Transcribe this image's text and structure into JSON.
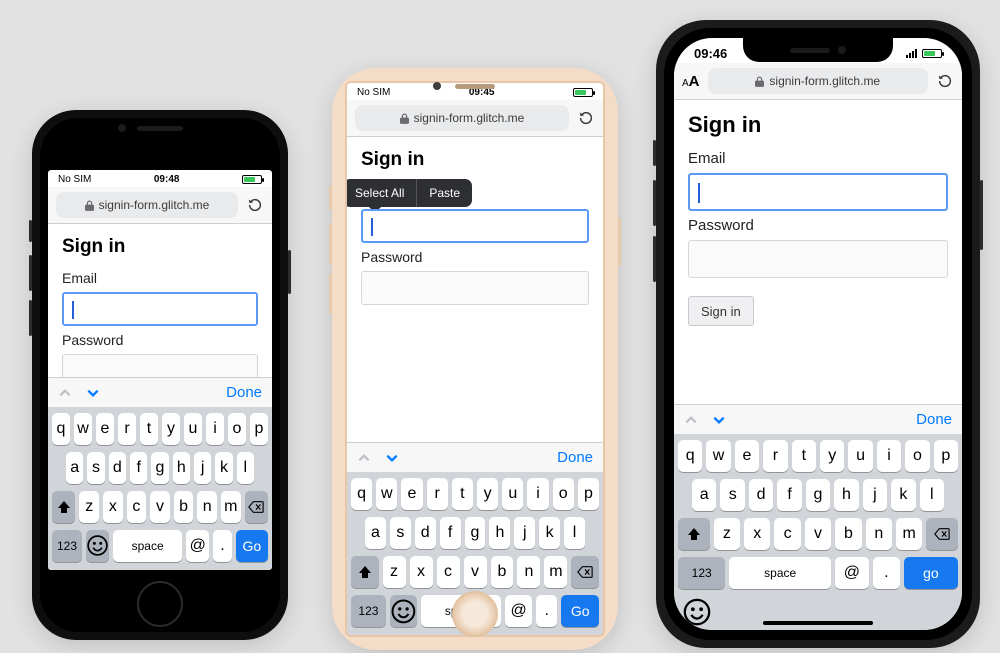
{
  "page": {
    "title": "Sign in",
    "email_label": "Email",
    "password_label": "Password",
    "signin_button": "Sign in"
  },
  "url": "signin-form.glitch.me",
  "phones": {
    "p1": {
      "carrier": "No SIM",
      "time": "09:48"
    },
    "p2": {
      "carrier": "No SIM",
      "time": "09:45"
    },
    "p3": {
      "time": "09:46"
    }
  },
  "context_menu": {
    "select_all": "Select All",
    "paste": "Paste"
  },
  "keyboard": {
    "done": "Done",
    "row1": [
      "q",
      "w",
      "e",
      "r",
      "t",
      "y",
      "u",
      "i",
      "o",
      "p"
    ],
    "row2": [
      "a",
      "s",
      "d",
      "f",
      "g",
      "h",
      "j",
      "k",
      "l"
    ],
    "row3": [
      "z",
      "x",
      "c",
      "v",
      "b",
      "n",
      "m"
    ],
    "numkey": "123",
    "space": "space",
    "at": "@",
    "dot": ".",
    "go_upper": "Go",
    "go_lower": "go"
  }
}
